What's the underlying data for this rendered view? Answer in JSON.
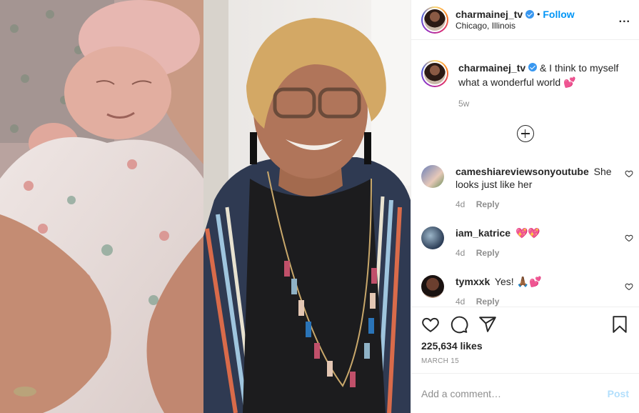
{
  "post": {
    "username": "charmainej_tv",
    "follow_label": "Follow",
    "separator": "•",
    "location": "Chicago, Illinois",
    "more_label": "...",
    "verified_icon": "verified-badge-icon"
  },
  "photos": {
    "left_subject": "newborn-baby",
    "right_subject": "smiling-woman"
  },
  "caption": {
    "username": "charmainej_tv",
    "text": "& I think to myself what a wonderful world 💕",
    "age": "5w"
  },
  "load_more_icon": "plus-circle-icon",
  "comments": [
    {
      "username": "cameshiareviewsonyoutube",
      "text": "She looks just like her",
      "age": "4d",
      "reply_label": "Reply"
    },
    {
      "username": "iam_katrice",
      "text": "💖💖",
      "age": "4d",
      "reply_label": "Reply"
    },
    {
      "username": "tymxxk",
      "text": "Yes! 🙏🏾💕",
      "age": "4d",
      "reply_label": "Reply"
    }
  ],
  "actions": {
    "likes": "225,634 likes",
    "date": "MARCH 15",
    "icons": [
      "heart-icon",
      "comment-icon",
      "share-icon",
      "bookmark-icon"
    ]
  },
  "add_comment": {
    "placeholder": "Add a comment…",
    "post_label": "Post"
  },
  "colors": {
    "link_blue": "#0095f6",
    "post_disabled": "#b2dffc",
    "muted": "#8e8e8e",
    "text": "#262626"
  }
}
